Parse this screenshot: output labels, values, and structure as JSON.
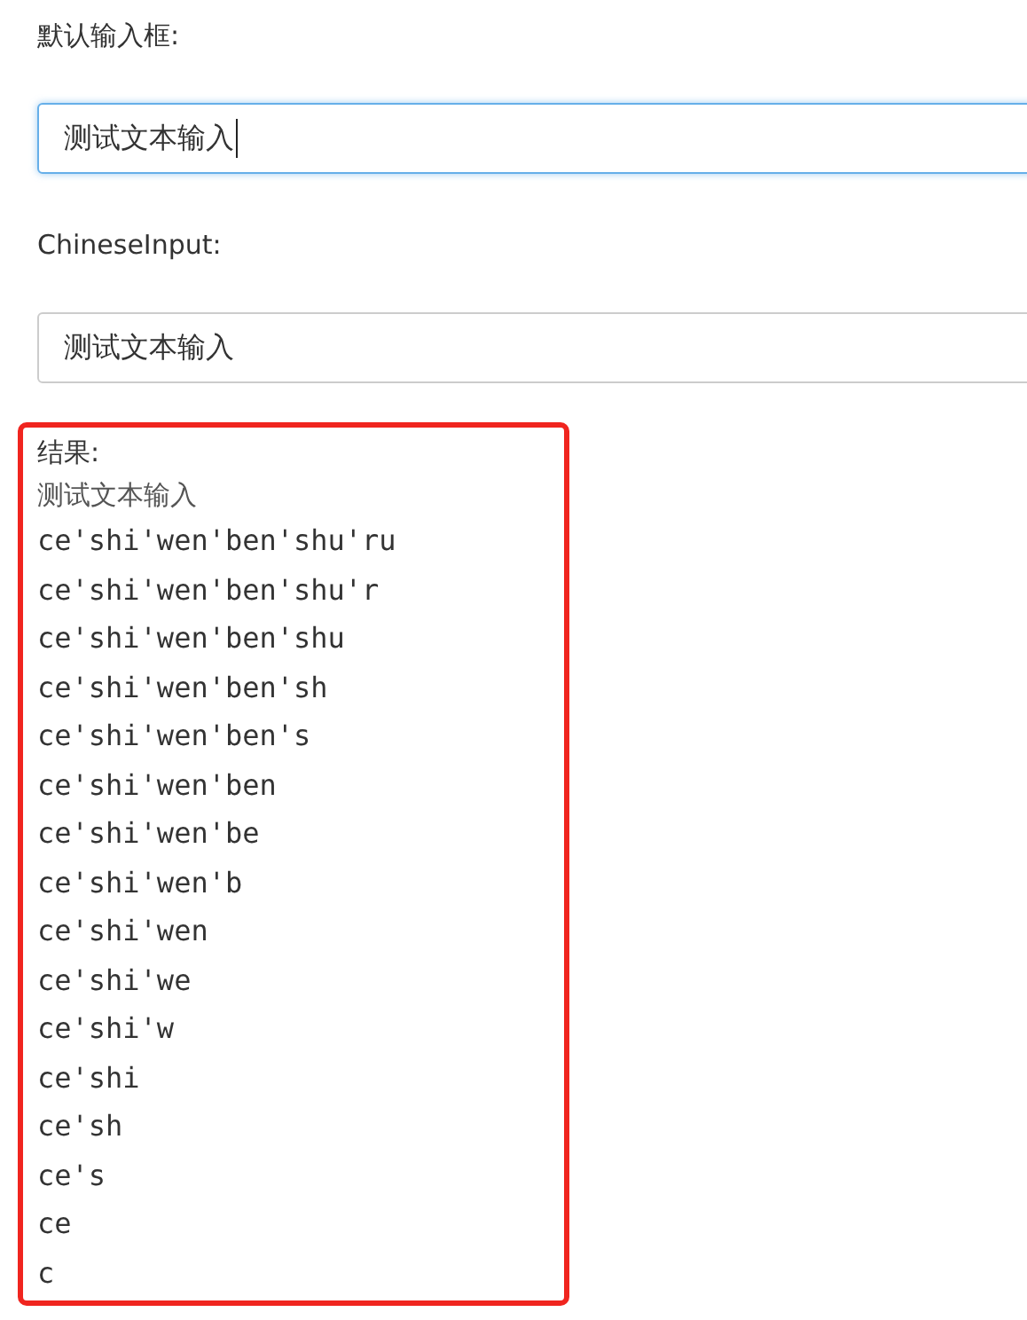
{
  "fields": [
    {
      "label": "默认输入框:",
      "value": "测试文本输入",
      "focused": true
    },
    {
      "label": "ChineseInput:",
      "value": "测试文本输入",
      "focused": false
    }
  ],
  "result": {
    "heading": "结果:",
    "text": "测试文本输入",
    "lines": [
      "ce'shi'wen'ben'shu'ru",
      "ce'shi'wen'ben'shu'r",
      "ce'shi'wen'ben'shu",
      "ce'shi'wen'ben'sh",
      "ce'shi'wen'ben's",
      "ce'shi'wen'ben",
      "ce'shi'wen'be",
      "ce'shi'wen'b",
      "ce'shi'wen",
      "ce'shi'we",
      "ce'shi'w",
      "ce'shi",
      "ce'sh",
      "ce's",
      "ce",
      "c"
    ]
  }
}
